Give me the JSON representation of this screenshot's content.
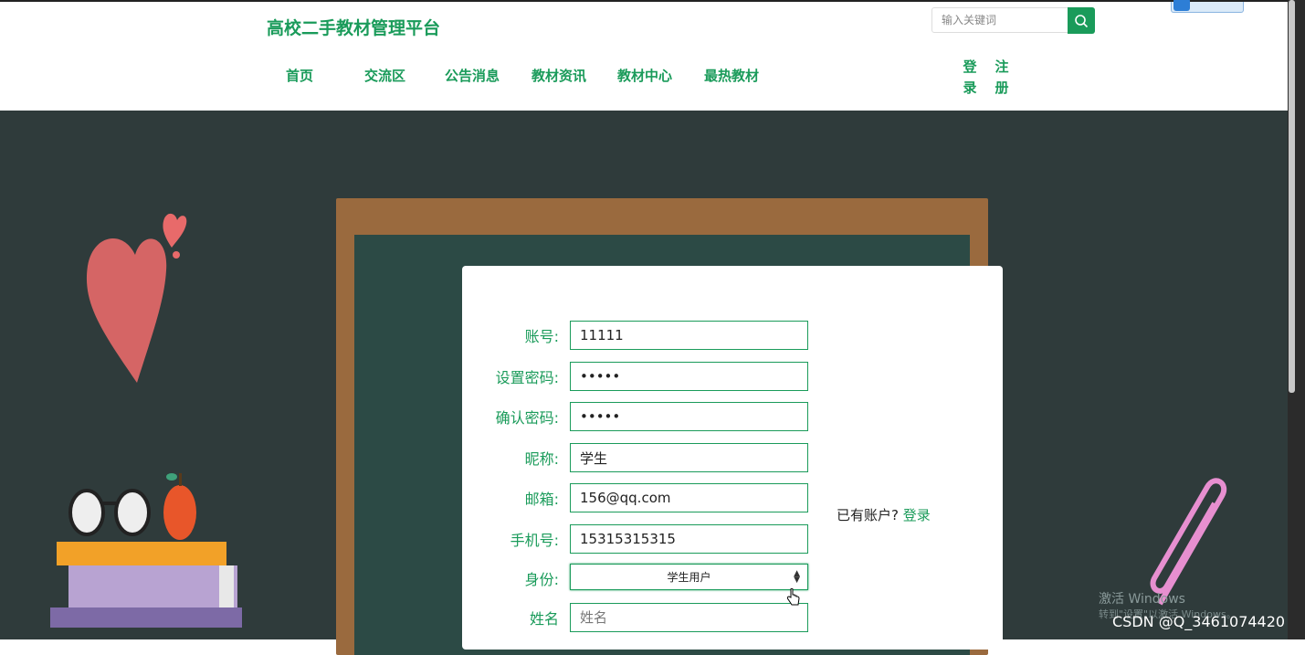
{
  "header": {
    "site_title": "高校二手教材管理平台",
    "search_placeholder": "输入关键词",
    "nav": [
      "首页",
      "交流区",
      "公告消息",
      "教材资讯",
      "教材中心",
      "最热教材"
    ],
    "login": "登录",
    "register": "注册"
  },
  "form": {
    "fields": [
      {
        "label": "账号:",
        "value": "11111",
        "type": "text"
      },
      {
        "label": "设置密码:",
        "value": "11111",
        "type": "password"
      },
      {
        "label": "确认密码:",
        "value": "11111",
        "type": "password"
      },
      {
        "label": "昵称:",
        "value": "学生",
        "type": "text"
      },
      {
        "label": "邮箱:",
        "value": "156@qq.com",
        "type": "text"
      },
      {
        "label": "手机号:",
        "value": "15315315315",
        "type": "text"
      }
    ],
    "identity_label": "身份:",
    "identity_value": "学生用户",
    "name_label": "姓名",
    "name_placeholder": "姓名",
    "have_account": "已有账户?",
    "login_link": "登录"
  },
  "overlay": {
    "activate_windows": "激活 Windows",
    "activate_hint": "转到\"设置\"以激活 Windows。",
    "csdn_credit": "CSDN @Q_3461074420"
  },
  "colors": {
    "accent": "#1a9b5a",
    "background": "#2f3b3b"
  }
}
